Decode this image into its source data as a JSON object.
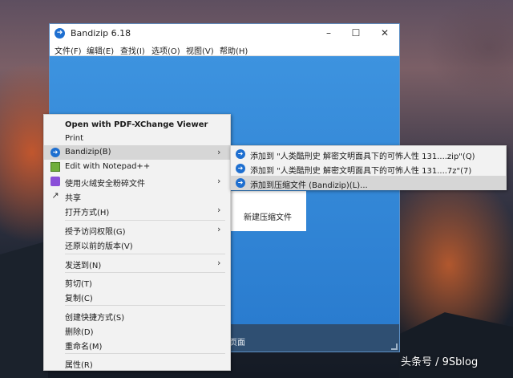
{
  "window": {
    "title": "Bandizip 6.18",
    "menubar": [
      "文件(F)",
      "编辑(E)",
      "查找(I)",
      "选项(O)",
      "视图(V)",
      "帮助(H)"
    ],
    "status_text": "页面",
    "new_archive_label": "新建压缩文件"
  },
  "context_menu": {
    "items": [
      {
        "label": "Open with PDF-XChange Viewer",
        "icon": "none"
      },
      {
        "label": "Print",
        "icon": "none"
      },
      {
        "label": "Bandizip(B)",
        "icon": "bandizip-icon"
      },
      {
        "label": "Edit with Notepad++",
        "icon": "notepad-icon"
      },
      {
        "label": "使用火绒安全粉碎文件",
        "icon": "huorong-icon"
      },
      {
        "label": "共享",
        "icon": "share-icon"
      },
      {
        "label": "打开方式(H)",
        "icon": "none"
      },
      {
        "label": "授予访问权限(G)",
        "icon": "none"
      },
      {
        "label": "还原以前的版本(V)",
        "icon": "none"
      },
      {
        "label": "发送到(N)",
        "icon": "none"
      },
      {
        "label": "剪切(T)",
        "icon": "none"
      },
      {
        "label": "复制(C)",
        "icon": "none"
      },
      {
        "label": "创建快捷方式(S)",
        "icon": "none"
      },
      {
        "label": "删除(D)",
        "icon": "none"
      },
      {
        "label": "重命名(M)",
        "icon": "none"
      },
      {
        "label": "属性(R)",
        "icon": "none"
      }
    ]
  },
  "submenu": {
    "items": [
      {
        "label": "添加到 \"人类酷刑史 解密文明面具下的可怖人性 131....zip\"(Q)"
      },
      {
        "label": "添加到 \"人类酷刑史 解密文明面具下的可怖人性 131....7z\"(7)"
      },
      {
        "label": "添加到压缩文件 (Bandizip)(L)..."
      }
    ]
  },
  "watermark": "头条号 / 9Sblog",
  "colors": {
    "accent": "#1e6fd0",
    "highlight": "#d6d6d6",
    "window_blue": "#2a7dd1"
  }
}
